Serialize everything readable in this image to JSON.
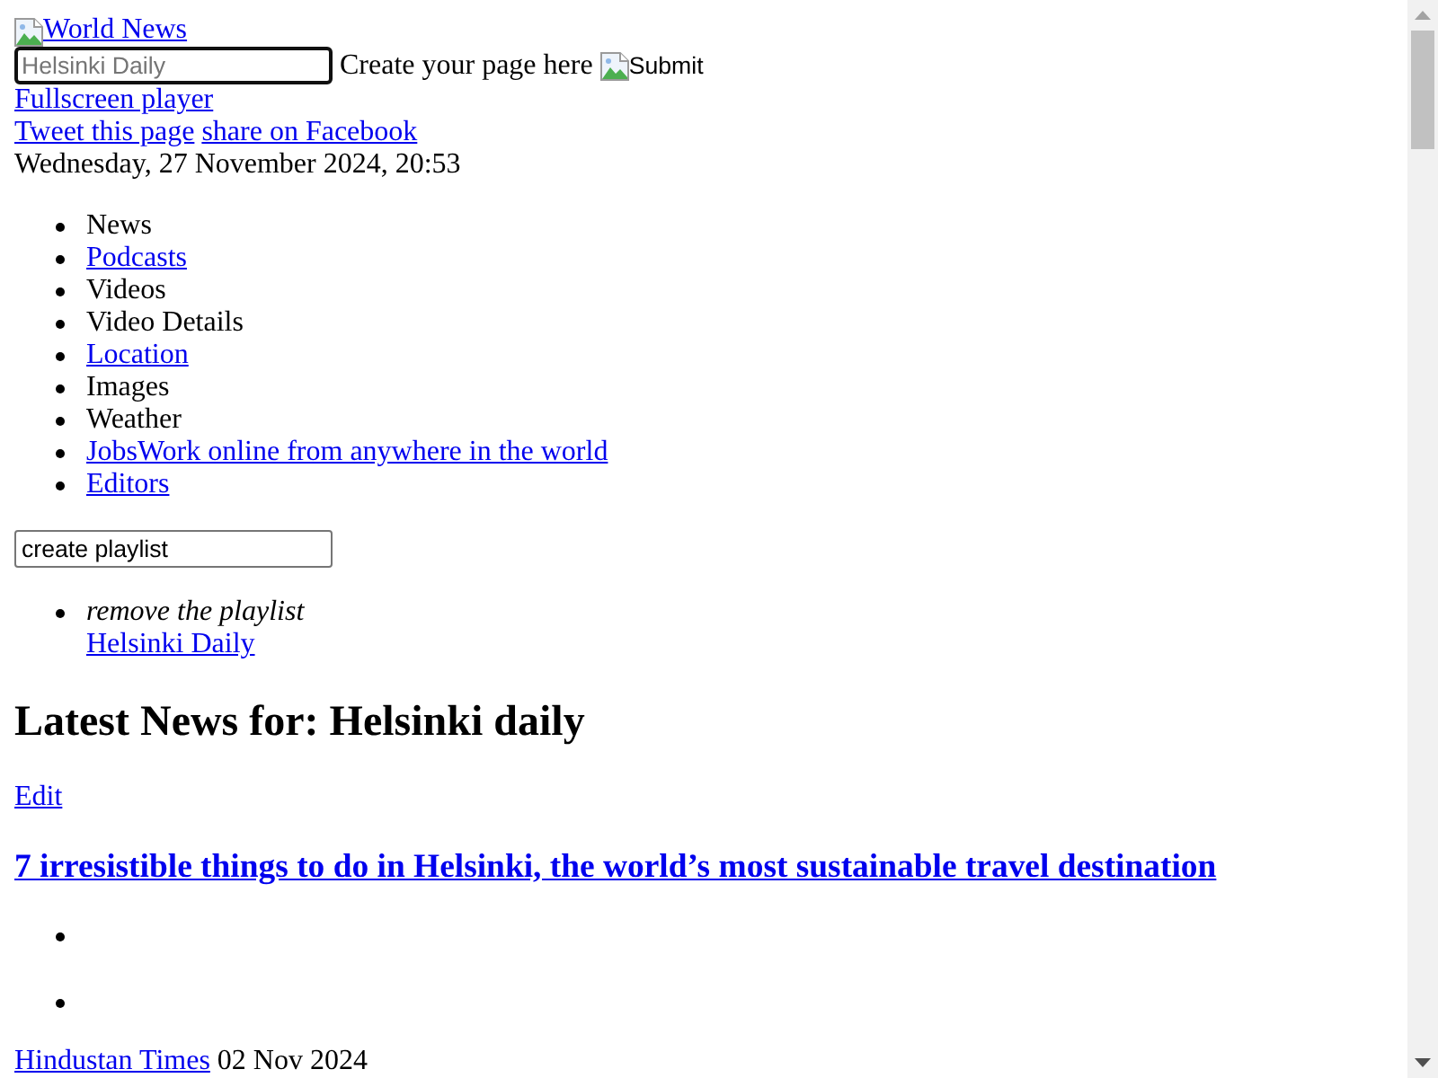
{
  "logo_link": "World News",
  "page_form": {
    "field": {
      "placeholder": "Helsinki Daily",
      "focused": true
    },
    "label": "Create your page here",
    "submit": "Submit"
  },
  "fullscreen_link": "Fullscreen player",
  "share_links": [
    "Tweet this page",
    "share on Facebook"
  ],
  "date": "Wednesday, 27 November 2024, 20:53",
  "nav": [
    {
      "label": "News",
      "kind": "text"
    },
    {
      "label": "Podcasts",
      "kind": "link"
    },
    {
      "label": "Videos",
      "kind": "text"
    },
    {
      "label": "Video Details",
      "kind": "text"
    },
    {
      "label": "Location",
      "kind": "link"
    },
    {
      "label": "Images",
      "kind": "text"
    },
    {
      "label": "Weather",
      "kind": "text"
    },
    {
      "label": "JobsWork online from anywhere in the world",
      "kind": "link"
    },
    {
      "label": "Editors",
      "kind": "link"
    }
  ],
  "playlist": {
    "field": {
      "value": "create playlist",
      "focused": false
    },
    "items": [
      {
        "remove_label": "remove the playlist",
        "link": "Helsinki Daily"
      }
    ]
  },
  "heading": "Latest News for: Helsinki daily",
  "edit_link": "Edit",
  "article": {
    "title": "7 irresistible things to do in Helsinki, the world’s most sustainable travel destination",
    "list_items": [
      {
        "kind": "bullet"
      },
      {
        "kind": "bullet"
      }
    ],
    "source": "Hindustan Times",
    "date": "02 Nov 2024"
  }
}
